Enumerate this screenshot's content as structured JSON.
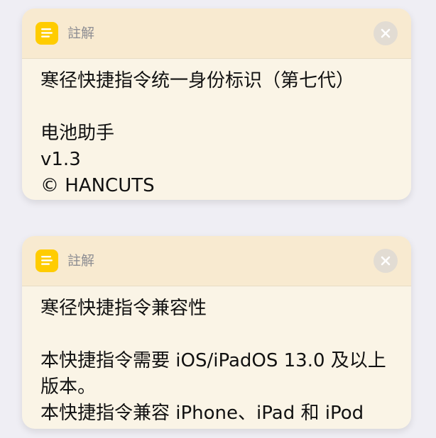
{
  "cards": [
    {
      "header_label": "註解",
      "body_text": "寒径快捷指令统一身份标识（第七代）\n\n电池助手\nv1.3\n© HANCUTS"
    },
    {
      "header_label": "註解",
      "body_text": "寒径快捷指令兼容性\n\n本快捷指令需要 iOS/iPadOS 13.0 及以上版本。\n本快捷指令兼容 iPhone、iPad 和 iPod"
    }
  ],
  "icons": {
    "note": "note-icon",
    "close": "close-icon"
  },
  "colors": {
    "note_icon_bg": "#ffcc00",
    "card_header_bg": "#f8ead0",
    "card_body_bg": "#faf4e6",
    "page_bg": "#efeef4"
  }
}
